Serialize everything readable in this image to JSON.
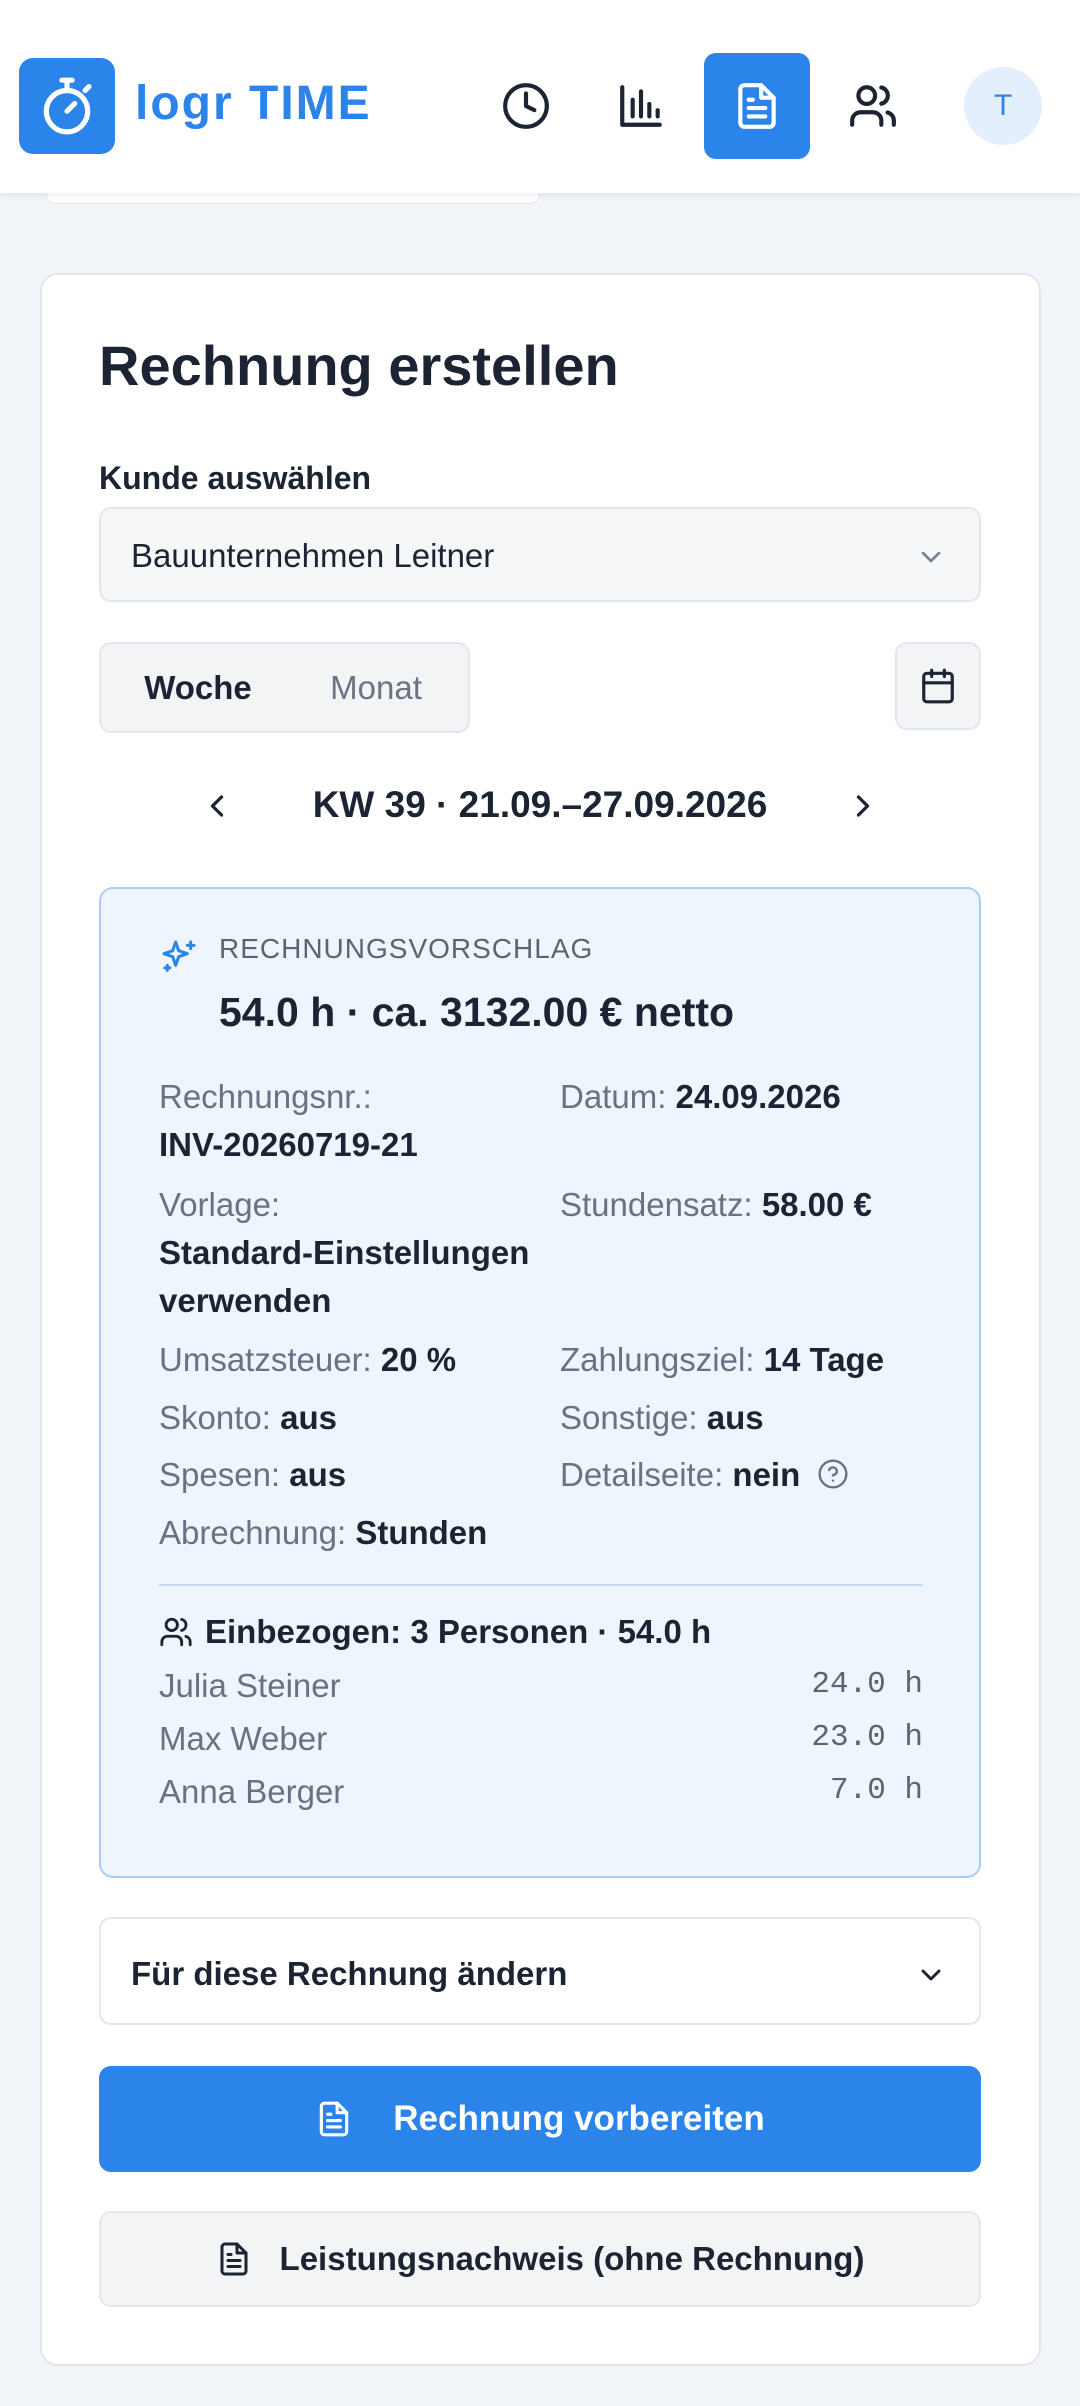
{
  "app": {
    "logo_text": "logr TIME",
    "avatar_initial": "T"
  },
  "nav": {
    "items": [
      {
        "name": "clock-icon",
        "active": false
      },
      {
        "name": "bar-chart-icon",
        "active": false
      },
      {
        "name": "document-icon",
        "active": true
      },
      {
        "name": "users-icon",
        "active": false
      }
    ]
  },
  "page": {
    "title": "Rechnung erstellen"
  },
  "customer": {
    "label": "Kunde auswählen",
    "selected": "Bauunternehmen Leitner"
  },
  "period": {
    "tabs": [
      "Woche",
      "Monat"
    ],
    "active_tab": "Woche",
    "week_label": "KW 39 · 21.09.–27.09.2026"
  },
  "proposal": {
    "kicker": "RECHNUNGSVORSCHLAG",
    "headline": "54.0 h · ca. 3132.00 € netto",
    "invoice_no_label": "Rechnungsnr.:",
    "invoice_no": "INV-20260719-21",
    "date_label": "Datum:",
    "date": "24.09.2026",
    "template_label": "Vorlage:",
    "template_line1": "Standard-Einstellungen",
    "template_line2": "verwenden",
    "rate_label": "Stundensatz:",
    "rate": "58.00 €",
    "vat_label": "Umsatzsteuer:",
    "vat": "20 %",
    "payment_label": "Zahlungsziel:",
    "payment": "14 Tage",
    "discount_label": "Skonto:",
    "discount": "aus",
    "other_label": "Sonstige:",
    "other": "aus",
    "expenses_label": "Spesen:",
    "expenses": "aus",
    "detail_label": "Detailseite:",
    "detail": "nein",
    "billing_label": "Abrechnung:",
    "billing": "Stunden",
    "included": "Einbezogen: 3 Personen · 54.0 h",
    "people": [
      {
        "name": "Julia Steiner",
        "hours": "24.0 h"
      },
      {
        "name": "Max Weber",
        "hours": "23.0 h"
      },
      {
        "name": "Anna Berger",
        "hours": "7.0 h"
      }
    ]
  },
  "actions": {
    "change_label": "Für diese Rechnung ändern",
    "prepare_label": "Rechnung vorbereiten",
    "proof_label": "Leistungsnachweis (ohne Rechnung)"
  },
  "colors": {
    "accent": "#2b84ea",
    "proposal_bg": "#eef5fd",
    "proposal_border": "#a9cef2"
  }
}
